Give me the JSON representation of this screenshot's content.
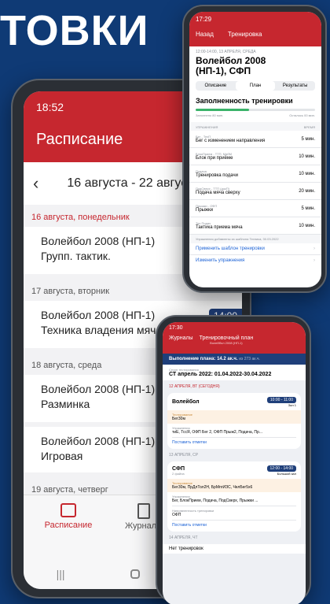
{
  "headline": "ТОВКИ",
  "left": {
    "time": "18:52",
    "title": "Расписание",
    "week": "16 августа - 22 августа",
    "days": [
      {
        "day": "16 августа, понедельник",
        "team": "Волейбол 2008 (НП-1)",
        "topic": "Групп. тактик.",
        "time": "13:"
      },
      {
        "day": "17 августа, вторник",
        "team": "Волейбол 2008 (НП-1)",
        "topic": "Техника владения мячом",
        "time": "14:00",
        "place": "Зал 1"
      },
      {
        "day": "18 августа, среда",
        "team": "Волейбол 2008 (НП-1)",
        "topic": "Разминка"
      },
      {
        "day": "",
        "team": "Волейбол 2008 (НП-1)",
        "topic": "Игровая"
      },
      {
        "day": "19 августа, четверг",
        "team": "Волейбол 2008 (НП-1)",
        "topic": "СФП"
      }
    ],
    "nav": {
      "schedule": "Расписание",
      "journals": "Журналы"
    }
  },
  "top": {
    "time": "17:29",
    "back": "Назад",
    "title": "Тренировка",
    "date": "12:00-14:00, 13 АПРЕЛЯ, СРЕДА",
    "team": "Волейбол 2008 (НП-1), СФП",
    "tabs": [
      "Описание",
      "План",
      "Результаты"
    ],
    "fill_title": "Заполненность тренировки",
    "filled": "Заполнено 80 мин.",
    "remaining": "Осталось 00 мин.",
    "col_ex": "УПРАЖНЕНИЯ",
    "col_time": "ВРЕМЯ",
    "exercises": [
      {
        "cat": "Бег - ТехП",
        "name": "Бег с изменением направления",
        "time": "5 мин."
      },
      {
        "cat": "БлокПрием - ТТП, МабМ",
        "name": "Блок при приёме",
        "time": "10 мин."
      },
      {
        "cat": "Подача",
        "name": "Тренировка подачи",
        "time": "10 мин."
      },
      {
        "cat": "ПодСверх - ТТП (докП)",
        "name": "Подача мяча сверху",
        "time": "20 мин."
      },
      {
        "cat": "Прыжки - ОФП",
        "name": "Прыжки",
        "time": "5 мин."
      },
      {
        "cat": "Тех Подач",
        "name": "Тактика приема мяча",
        "time": "10 мин."
      }
    ],
    "note": "Упражнения добавлены из шаблона Техника, 30.03.2022",
    "apply": "Применить шаблон тренировки",
    "change": "Изменить упражнения"
  },
  "bottom": {
    "time": "17:30",
    "back": "Журналы",
    "title": "Тренировочный план",
    "subtitle": "Волейбол 2008 (НП-1)",
    "plan_label": "Выполнение плана: 14.2 ак.ч.",
    "plan_of": "из 273 ак.ч.",
    "period_label": "Сезон тестирования",
    "period": "СТ апрель 2022: 01.04.2022-30.04.2022",
    "day1": "12 АПРЕЛЯ, ВТ (СЕГОДНЯ)",
    "card1": {
      "title": "Волейбол",
      "time": "10:00 - 11:00",
      "place": "Зал 1",
      "plan_label": "Тестирование",
      "plan": "Бег30м",
      "ex_label": "Упражнения",
      "ex": "тиЕ, ТссЯ, ОФП Бег 2, ОФП Прыж2, Подача, Пр...",
      "mark": "Поставить отметки"
    },
    "day2": "13 АПРЕЛЯ, СР",
    "card2": {
      "title": "СФП",
      "subtitle": "2 файла",
      "time": "12:00 - 14:00",
      "place": "Большой зал",
      "plan_label": "Тестирование",
      "plan": "Бег30м, ПрДлТол2Н, БрМпгИЗС, ЧелБег5х6",
      "ex_label": "Упражнения",
      "ex": "Бег, БлокПрием, Подача, ПодСверх, Прыжки ...",
      "dir_label": "Направленность тренировки",
      "dir": "ОФП",
      "mark": "Поставить отметки"
    },
    "day3": "14 АПРЕЛЯ, ЧТ",
    "none": "Нет тренировок"
  }
}
